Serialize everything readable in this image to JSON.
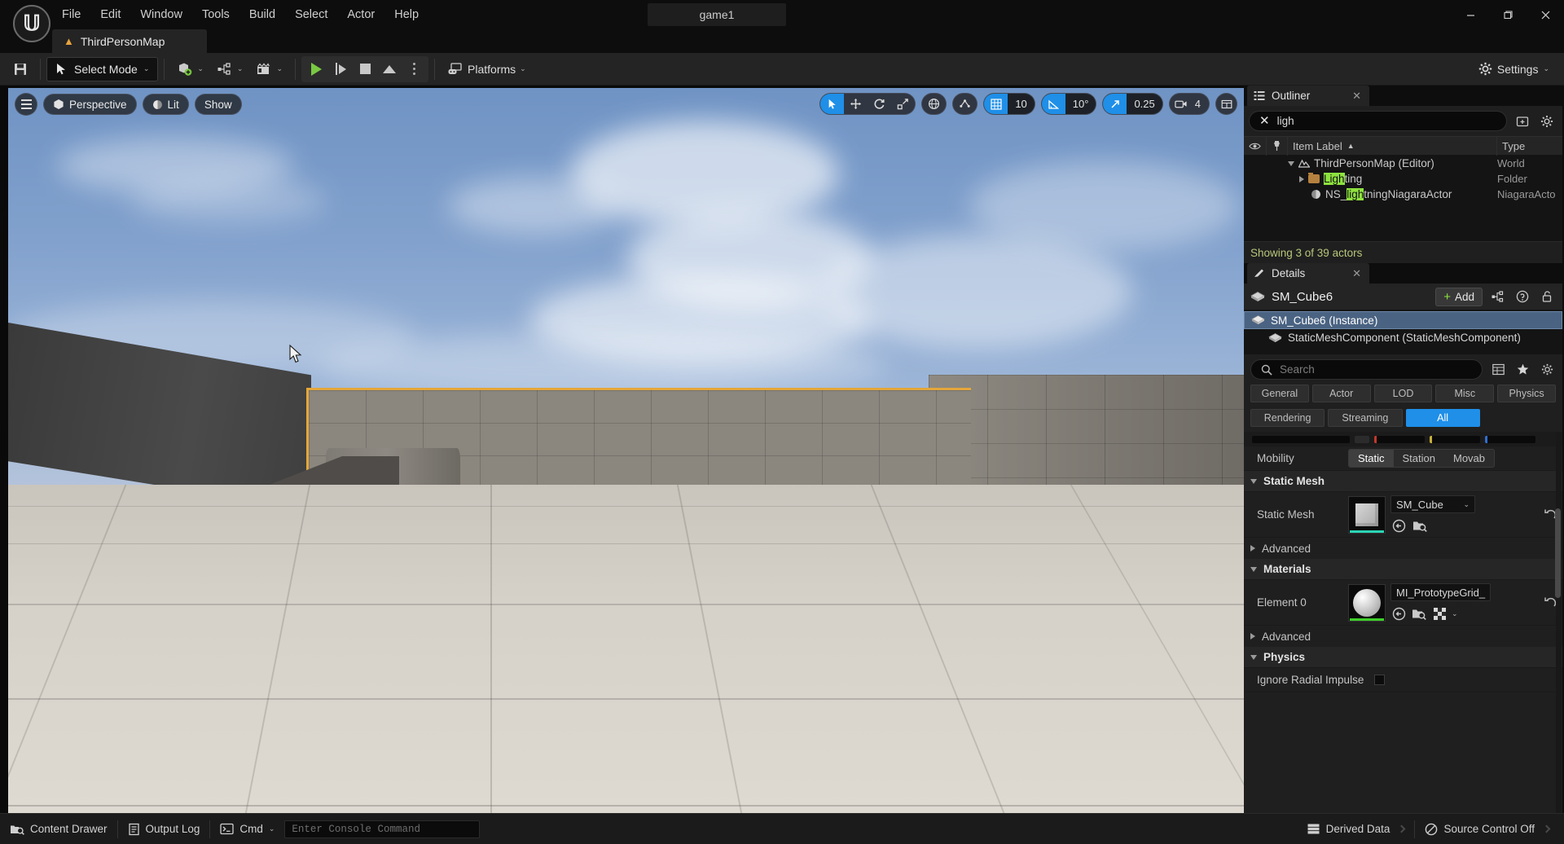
{
  "window": {
    "title": "game1",
    "controls": {
      "minimize": "—",
      "maximize": "❐",
      "close": "✕"
    }
  },
  "menubar": {
    "items": [
      {
        "label": "File"
      },
      {
        "label": "Edit"
      },
      {
        "label": "Window"
      },
      {
        "label": "Tools"
      },
      {
        "label": "Build"
      },
      {
        "label": "Select"
      },
      {
        "label": "Actor"
      },
      {
        "label": "Help"
      }
    ]
  },
  "tabs": [
    {
      "label": "ThirdPersonMap",
      "icon": "map-icon",
      "active": true
    }
  ],
  "toolbar": {
    "save_icon": "save-icon",
    "mode": {
      "label": "Select Mode",
      "chevron": "⌄"
    },
    "quick_add": {
      "icon": "add-actor-icon",
      "chevron": "⌄"
    },
    "blueprints": {
      "icon": "blueprint-icon",
      "chevron": "⌄"
    },
    "cinematics": {
      "icon": "cinematics-icon",
      "chevron": "⌄"
    },
    "play": {
      "icon": "play-icon"
    },
    "skip": {
      "icon": "step-icon"
    },
    "stop": {
      "icon": "stop-icon"
    },
    "eject": {
      "icon": "eject-icon"
    },
    "more": {
      "icon": "more-options-icon"
    },
    "platforms": {
      "label": "Platforms",
      "chevron": "⌄"
    },
    "settings": {
      "label": "Settings",
      "chevron": "⌄"
    }
  },
  "viewport": {
    "menu_icon": "viewport-menu-icon",
    "camera_label": "Perspective",
    "view_mode_label": "Lit",
    "show_label": "Show",
    "transform_tools": [
      {
        "name": "select-tool",
        "active": true
      },
      {
        "name": "move-tool",
        "active": false
      },
      {
        "name": "rotate-tool",
        "active": false
      },
      {
        "name": "scale-tool",
        "active": false
      }
    ],
    "coordinate_system": "world-space-icon",
    "surface_snap": "surface-snap-icon",
    "grid_snap": {
      "icon": "grid-snap-icon",
      "value": "10",
      "enabled": true
    },
    "angle_snap": {
      "icon": "angle-snap-icon",
      "value": "10°",
      "enabled": true
    },
    "scale_snap": {
      "icon": "scale-snap-icon",
      "value": "0.25",
      "enabled": true
    },
    "camera_speed": {
      "icon": "camera-speed-icon",
      "value": "4"
    },
    "maximize": {
      "icon": "maximize-viewport-icon"
    }
  },
  "outliner": {
    "tab_label": "Outliner",
    "tab_icon": "outliner-icon",
    "close_icon": "✕",
    "search": {
      "value": "ligh",
      "clear_icon": "✕"
    },
    "toolbar_icons": [
      "save-search-icon",
      "settings-gear-icon"
    ],
    "columns": [
      {
        "label": "",
        "name": "visibility-column",
        "icon": "eye-icon"
      },
      {
        "label": "",
        "name": "pin-column",
        "icon": "pin-icon"
      },
      {
        "label": "Item Label",
        "name": "item-label-column",
        "sort": "▲"
      },
      {
        "label": "Type",
        "name": "type-column"
      }
    ],
    "rows": [
      {
        "indent": 1,
        "expander": "open",
        "icon": "world-icon",
        "label": "ThirdPersonMap (Editor)",
        "type": "World",
        "highlight": ""
      },
      {
        "indent": 2,
        "expander": "closed",
        "icon": "folder-icon",
        "label": "Lighting",
        "type": "Folder",
        "highlight": "Ligh"
      },
      {
        "indent": 3,
        "expander": "none",
        "icon": "niagara-icon",
        "label": "NS_lightningNiagaraActor",
        "type": "NiagaraActo",
        "highlight": "ligh"
      }
    ],
    "status": "Showing 3 of 39 actors"
  },
  "details": {
    "tab_label": "Details",
    "tab_icon": "details-icon",
    "close_icon": "✕",
    "actor_name": "SM_Cube6",
    "actor_icon": "static-mesh-icon",
    "add_button": {
      "label": "Add",
      "plus": "+"
    },
    "header_icons": [
      "blueprint-icon",
      "help-icon",
      "lock-icon"
    ],
    "components": [
      {
        "label": "SM_Cube6 (Instance)",
        "icon": "static-mesh-icon",
        "selected": true,
        "indent": 0
      },
      {
        "label": "StaticMeshComponent (StaticMeshComponent)",
        "icon": "static-mesh-icon",
        "selected": false,
        "indent": 1
      }
    ],
    "search": {
      "placeholder": "Search",
      "icon": "search-icon"
    },
    "search_icons": [
      "column-layout-icon",
      "favorites-star-icon",
      "settings-gear-icon"
    ],
    "filters": [
      {
        "label": "General",
        "active": false
      },
      {
        "label": "Actor",
        "active": false
      },
      {
        "label": "LOD",
        "active": false
      },
      {
        "label": "Misc",
        "active": false
      },
      {
        "label": "Physics",
        "active": false
      },
      {
        "label": "Rendering",
        "active": false
      },
      {
        "label": "Streaming",
        "active": false
      },
      {
        "label": "All",
        "active": true
      }
    ],
    "properties": {
      "mobility": {
        "label": "Mobility",
        "options": [
          {
            "label": "Static",
            "selected": true
          },
          {
            "label": "Station",
            "selected": false
          },
          {
            "label": "Movab",
            "selected": false
          }
        ]
      },
      "static_mesh_section": {
        "label": "Static Mesh",
        "expanded": true
      },
      "static_mesh": {
        "label": "Static Mesh",
        "asset": "SM_Cube",
        "chevron": "⌄",
        "accent_color": "#2ad6b5",
        "icons": [
          "browse-to-asset-icon",
          "find-in-content-browser-icon"
        ],
        "reset_icon": "reset-arrow-icon"
      },
      "static_mesh_advanced": {
        "label": "Advanced",
        "expanded": false
      },
      "materials_section": {
        "label": "Materials",
        "expanded": true
      },
      "element0": {
        "label": "Element 0",
        "asset": "MI_PrototypeGrid_",
        "accent_color": "#3ecf2a",
        "icons": [
          "browse-to-asset-icon",
          "find-in-content-browser-icon",
          "checker-material-icon"
        ],
        "chevron": "⌄",
        "reset_icon": "reset-arrow-icon"
      },
      "materials_advanced": {
        "label": "Advanced",
        "expanded": false
      },
      "physics_section": {
        "label": "Physics",
        "expanded": true
      },
      "ignore_radial_impulse": {
        "label": "Ignore Radial Impulse",
        "checked": false
      }
    }
  },
  "statusbar": {
    "content_drawer": {
      "label": "Content Drawer",
      "icon": "content-drawer-icon"
    },
    "output_log": {
      "label": "Output Log",
      "icon": "output-log-icon"
    },
    "cmd": {
      "label": "Cmd",
      "icon": "cmd-icon",
      "chevron": "⌄"
    },
    "console": {
      "placeholder": "Enter Console Command"
    },
    "derived_data": {
      "label": "Derived Data",
      "icon": "derived-data-icon"
    },
    "source_control": {
      "label": "Source Control Off",
      "icon": "source-control-off-icon"
    }
  },
  "colors": {
    "accent_blue": "#1f8fe8",
    "selection_orange": "#e4a73a",
    "highlight_green": "#8ee23f",
    "status_text": "#b8c77a"
  }
}
